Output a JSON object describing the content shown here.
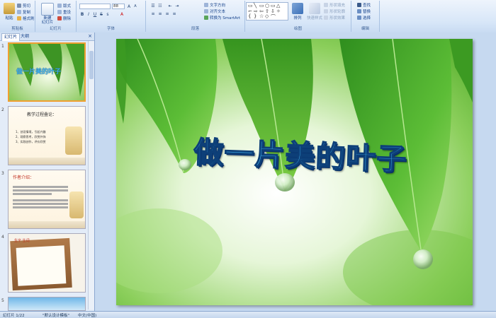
{
  "ribbon": {
    "clipboard": {
      "paste": "粘贴",
      "cut": "剪切",
      "copy": "复制",
      "format_painter": "格式刷",
      "label": "剪贴板"
    },
    "slides": {
      "new_slide": "新建\n幻灯片",
      "layout": "版式",
      "reset": "重设",
      "delete": "删除",
      "label": "幻灯片"
    },
    "font": {
      "size": "88",
      "bold": "B",
      "italic": "I",
      "underline": "U",
      "strike": "S",
      "shadow": "s",
      "label": "字体"
    },
    "paragraph": {
      "text_direction": "文字方向",
      "align_text": "对齐文本",
      "smartart": "转换为 SmartArt",
      "label": "段落"
    },
    "drawing": {
      "arrange": "排列",
      "quick_styles": "快速样式",
      "shape_fill": "形状填充",
      "shape_outline": "形状轮廓",
      "shape_effects": "形状效果",
      "label": "绘图"
    },
    "editing": {
      "find": "查找",
      "replace": "替换",
      "select": "选择",
      "label": "编辑"
    }
  },
  "leftpane": {
    "tabs": [
      "幻灯片",
      "大纲"
    ],
    "slides": [
      {
        "num": "1",
        "title": "做一片美的叶子"
      },
      {
        "num": "2",
        "title": "教学过程叠论：",
        "lines": [
          "1、创设情境，引起兴趣",
          "2、观察思考，欣赏外饰",
          "3、实践创作，评价欣赏"
        ]
      },
      {
        "num": "3",
        "title": "作者介绍："
      },
      {
        "num": "4",
        "title": "生字 生词"
      },
      {
        "num": "5"
      }
    ]
  },
  "slide": {
    "title": "做一片美的叶子"
  },
  "status": {
    "slide_info": "幻灯片 1/22",
    "theme": "\"默认设计模板\"",
    "language": "中文(中国)"
  },
  "colors": {
    "ribbon_bg": "#dbe7f7",
    "title_fill": "#3fb3f0",
    "leaf": "#4fae2a"
  }
}
